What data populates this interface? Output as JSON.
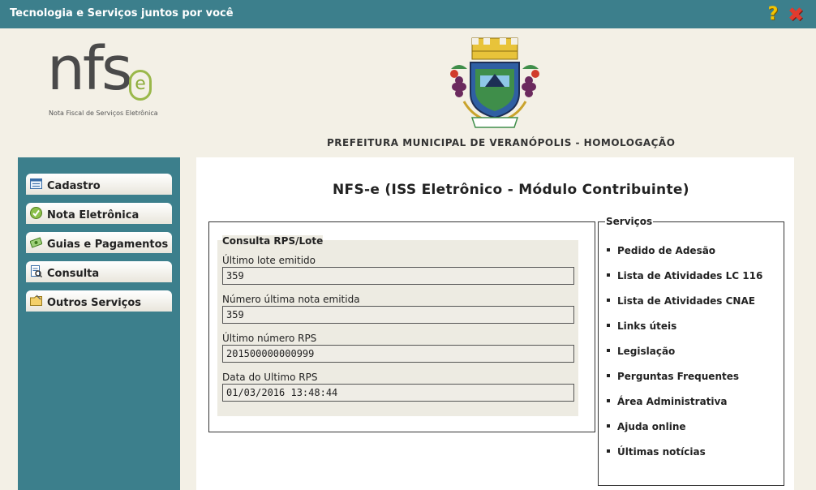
{
  "window": {
    "title": "Tecnologia e Serviços juntos por você",
    "help_icon": "?",
    "close_icon": "✖"
  },
  "header": {
    "logo_main": "nfs",
    "logo_e": "e",
    "logo_subtitle": "Nota Fiscal de Serviços Eletrônica",
    "prefeitura": "PREFEITURA MUNICIPAL DE VERANÓPOLIS - HOMOLOGAÇÃO",
    "crest_ribbon": "VERANÓPOLIS"
  },
  "sidebar": {
    "items": [
      {
        "label": "Cadastro",
        "icon": "form-icon"
      },
      {
        "label": "Nota Eletrônica",
        "icon": "green-check-icon"
      },
      {
        "label": "Guias e Pagamentos",
        "icon": "money-icon"
      },
      {
        "label": "Consulta",
        "icon": "search-document-icon"
      },
      {
        "label": "Outros Serviços",
        "icon": "folder-icon"
      }
    ]
  },
  "main": {
    "title": "NFS-e (ISS Eletrônico - Módulo Contribuinte)",
    "consulta": {
      "legend": "Consulta RPS/Lote",
      "fields": [
        {
          "label": "Último lote emitido",
          "value": "359"
        },
        {
          "label": "Número última nota emitida",
          "value": "359"
        },
        {
          "label": "Último número RPS",
          "value": "201500000000999"
        },
        {
          "label": "Data do Ultimo RPS",
          "value": "01/03/2016 13:48:44"
        }
      ]
    },
    "servicos": {
      "legend": "Serviços",
      "items": [
        "Pedido de Adesão",
        "Lista de Atividades LC 116",
        "Lista de Atividades CNAE",
        "Links úteis",
        "Legislação",
        "Perguntas Frequentes",
        "Área Administrativa",
        "Ajuda online",
        "Últimas notícias"
      ]
    }
  },
  "colors": {
    "teal": "#3c7f8c",
    "background": "#f3f0e6",
    "logo_green": "#9ab84a"
  }
}
